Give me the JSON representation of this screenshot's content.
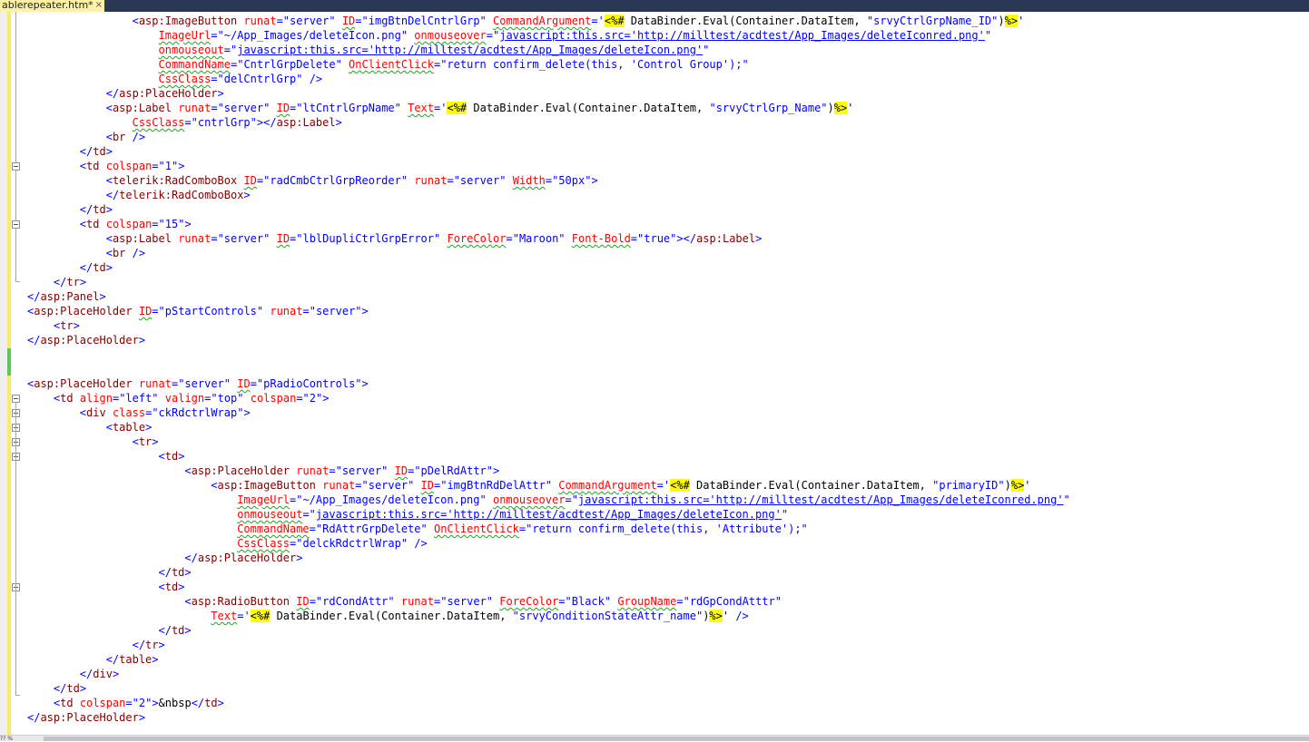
{
  "tab": {
    "title": "ablerepeater.htm*",
    "close_glyph": "×"
  },
  "statusbar": {
    "position_fragment": "?? %"
  },
  "colors": {
    "tag": "#0000ff",
    "element": "#800000",
    "attribute": "#ff0000",
    "value": "#0000ff",
    "server_block_highlight": "#ffff00",
    "squiggle": "#2a9d2a"
  },
  "code": {
    "lines": [
      "                <asp:ImageButton runat=\"server\" ID=\"imgBtnDelCntrlGrp\" CommandArgument='<%# DataBinder.Eval(Container.DataItem, \"srvyCtrlGrpName_ID\")%>'",
      "                    ImageUrl=\"~/App_Images/deleteIcon.png\" onmouseover=\"javascript:this.src='http://milltest/acdtest/App_Images/deleteIconred.png'\"",
      "                    onmouseout=\"javascript:this.src='http://milltest/acdtest/App_Images/deleteIcon.png'\"",
      "                    CommandName=\"CntrlGrpDelete\" OnClientClick=\"return confirm_delete(this, 'Control Group');\"",
      "                    CssClass=\"delCntrlGrp\" />",
      "            </asp:PlaceHolder>",
      "            <asp:Label runat=\"server\" ID=\"ltCntrlGrpName\" Text='<%# DataBinder.Eval(Container.DataItem, \"srvyCtrlGrp_Name\")%>'",
      "                CssClass=\"cntrlGrp\"></asp:Label>",
      "            <br />",
      "        </td>",
      "        <td colspan=\"1\">",
      "            <telerik:RadComboBox ID=\"radCmbCtrlGrpReorder\" runat=\"server\" Width=\"50px\">",
      "            </telerik:RadComboBox>",
      "        </td>",
      "        <td colspan=\"15\">",
      "            <asp:Label runat=\"server\" ID=\"lblDupliCtrlGrpError\" ForeColor=\"Maroon\" Font-Bold=\"true\"></asp:Label>",
      "            <br />",
      "        </td>",
      "    </tr>",
      "</asp:Panel>",
      "<asp:PlaceHolder ID=\"pStartControls\" runat=\"server\">",
      "    <tr>",
      "</asp:PlaceHolder>",
      "",
      "",
      "<asp:PlaceHolder runat=\"server\" ID=\"pRadioControls\">",
      "    <td align=\"left\" valign=\"top\" colspan=\"2\">",
      "        <div class=\"ckRdctrlWrap\">",
      "            <table>",
      "                <tr>",
      "                    <td>",
      "                        <asp:PlaceHolder runat=\"server\" ID=\"pDelRdAttr\">",
      "                            <asp:ImageButton runat=\"server\" ID=\"imgBtnRdDelAttr\" CommandArgument='<%# DataBinder.Eval(Container.DataItem, \"primaryID\")%>'",
      "                                ImageUrl=\"~/App_Images/deleteIcon.png\" onmouseover=\"javascript:this.src='http://milltest/acdtest/App_Images/deleteIconred.png'\"",
      "                                onmouseout=\"javascript:this.src='http://milltest/acdtest/App_Images/deleteIcon.png'\"",
      "                                CommandName=\"RdAttrGrpDelete\" OnClientClick=\"return confirm_delete(this, 'Attribute');\"",
      "                                CssClass=\"delckRdctrlWrap\" />",
      "                        </asp:PlaceHolder>",
      "                    </td>",
      "                    <td>",
      "                        <asp:RadioButton ID=\"rdCondAttr\" runat=\"server\" ForeColor=\"Black\" GroupName=\"rdGpCondAtttr\"",
      "                            Text='<%# DataBinder.Eval(Container.DataItem, \"srvyConditionStateAttr_name\")%>' />",
      "                    </td>",
      "                </tr>",
      "            </table>",
      "        </div>",
      "    </td>",
      "    <td colspan=\"2\">&nbsp</td>",
      "</asp:PlaceHolder>"
    ]
  }
}
